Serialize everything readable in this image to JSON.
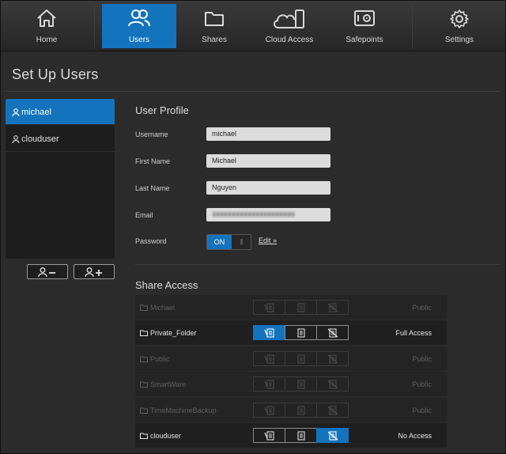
{
  "nav": {
    "items": [
      {
        "label": "Home",
        "icon": "home-icon"
      },
      {
        "label": "Users",
        "icon": "users-icon"
      },
      {
        "label": "Shares",
        "icon": "folder-icon"
      },
      {
        "label": "Cloud Access",
        "icon": "cloud-device-icon"
      },
      {
        "label": "Safepoints",
        "icon": "safe-icon"
      },
      {
        "label": "Settings",
        "icon": "gear-icon"
      }
    ],
    "active": "Users"
  },
  "page": {
    "title": "Set Up Users"
  },
  "users": {
    "items": [
      {
        "name": "michael",
        "selected": true
      },
      {
        "name": "clouduser",
        "selected": false
      }
    ],
    "remove_icon": "remove-user-icon",
    "add_icon": "add-user-icon"
  },
  "profile": {
    "title": "User Profile",
    "username_label": "Username",
    "username_value": "michael",
    "first_name_label": "First Name",
    "first_name_value": "Michael",
    "last_name_label": "Last Name",
    "last_name_value": "Nguyen",
    "email_label": "Email",
    "password_label": "Password",
    "password_toggle": "ON",
    "password_grip": "|||",
    "edit_link": "Edit »"
  },
  "share_access": {
    "title": "Share Access",
    "rows": [
      {
        "name": "Michael",
        "status": "Public",
        "enabled": false,
        "selected": -1
      },
      {
        "name": "Private_Folder",
        "status": "Full Access",
        "enabled": true,
        "selected": 0
      },
      {
        "name": "Public",
        "status": "Public",
        "enabled": false,
        "selected": -1
      },
      {
        "name": "SmartWare",
        "status": "Public",
        "enabled": false,
        "selected": -1
      },
      {
        "name": "TimeMachineBackup",
        "status": "Public",
        "enabled": false,
        "selected": -1
      },
      {
        "name": "clouduser",
        "status": "No Access",
        "enabled": true,
        "selected": 2
      }
    ]
  },
  "colors": {
    "accent": "#1473bd",
    "background": "#2b2b2b",
    "panel": "#1d1d1d"
  }
}
